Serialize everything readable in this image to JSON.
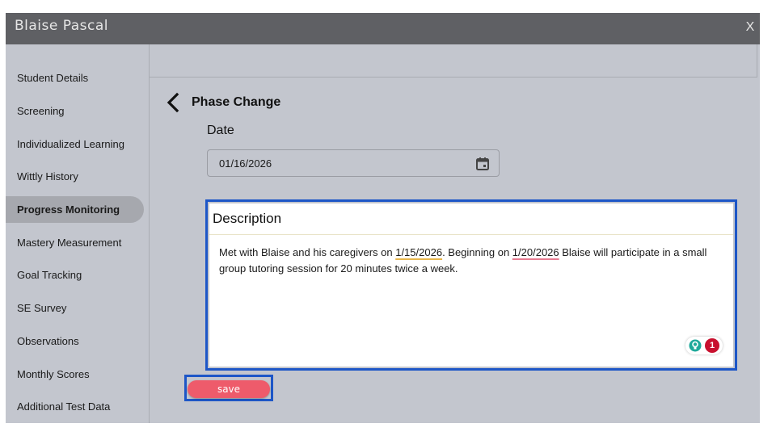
{
  "window": {
    "title": "Blaise Pascal",
    "close_label": "X"
  },
  "sidebar": {
    "items": [
      {
        "label": "Student Details",
        "active": false
      },
      {
        "label": "Screening",
        "active": false
      },
      {
        "label": "Individualized Learning",
        "active": false
      },
      {
        "label": "Wittly History",
        "active": false
      },
      {
        "label": "Progress Monitoring",
        "active": true
      },
      {
        "label": "Mastery Measurement",
        "active": false
      },
      {
        "label": "Goal Tracking",
        "active": false
      },
      {
        "label": "SE Survey",
        "active": false
      },
      {
        "label": "Observations",
        "active": false
      },
      {
        "label": "Monthly Scores",
        "active": false
      },
      {
        "label": "Additional Test Data",
        "active": false
      }
    ]
  },
  "main": {
    "heading": "Phase Change",
    "back_icon": "chevron-left-icon",
    "date_label": "Date",
    "date_value": "01/16/2026",
    "calendar_icon": "calendar-icon",
    "description": {
      "title": "Description",
      "text_parts": [
        "Met with Blaise and his caregivers on ",
        "1/15/2026",
        ". Beginning on ",
        "1/20/2026",
        " Blaise will participate in a small group tutoring session for 20 minutes twice a week."
      ],
      "grammar_badge": {
        "icon": "lightbulb-icon",
        "count": "1"
      }
    },
    "save_label": "save"
  },
  "colors": {
    "titlebar": "#5f6064",
    "background": "#c3c6ce",
    "focus_outline": "#1d56c7",
    "save_button": "#ee5b6b",
    "active_item": "#a6a8ae"
  }
}
